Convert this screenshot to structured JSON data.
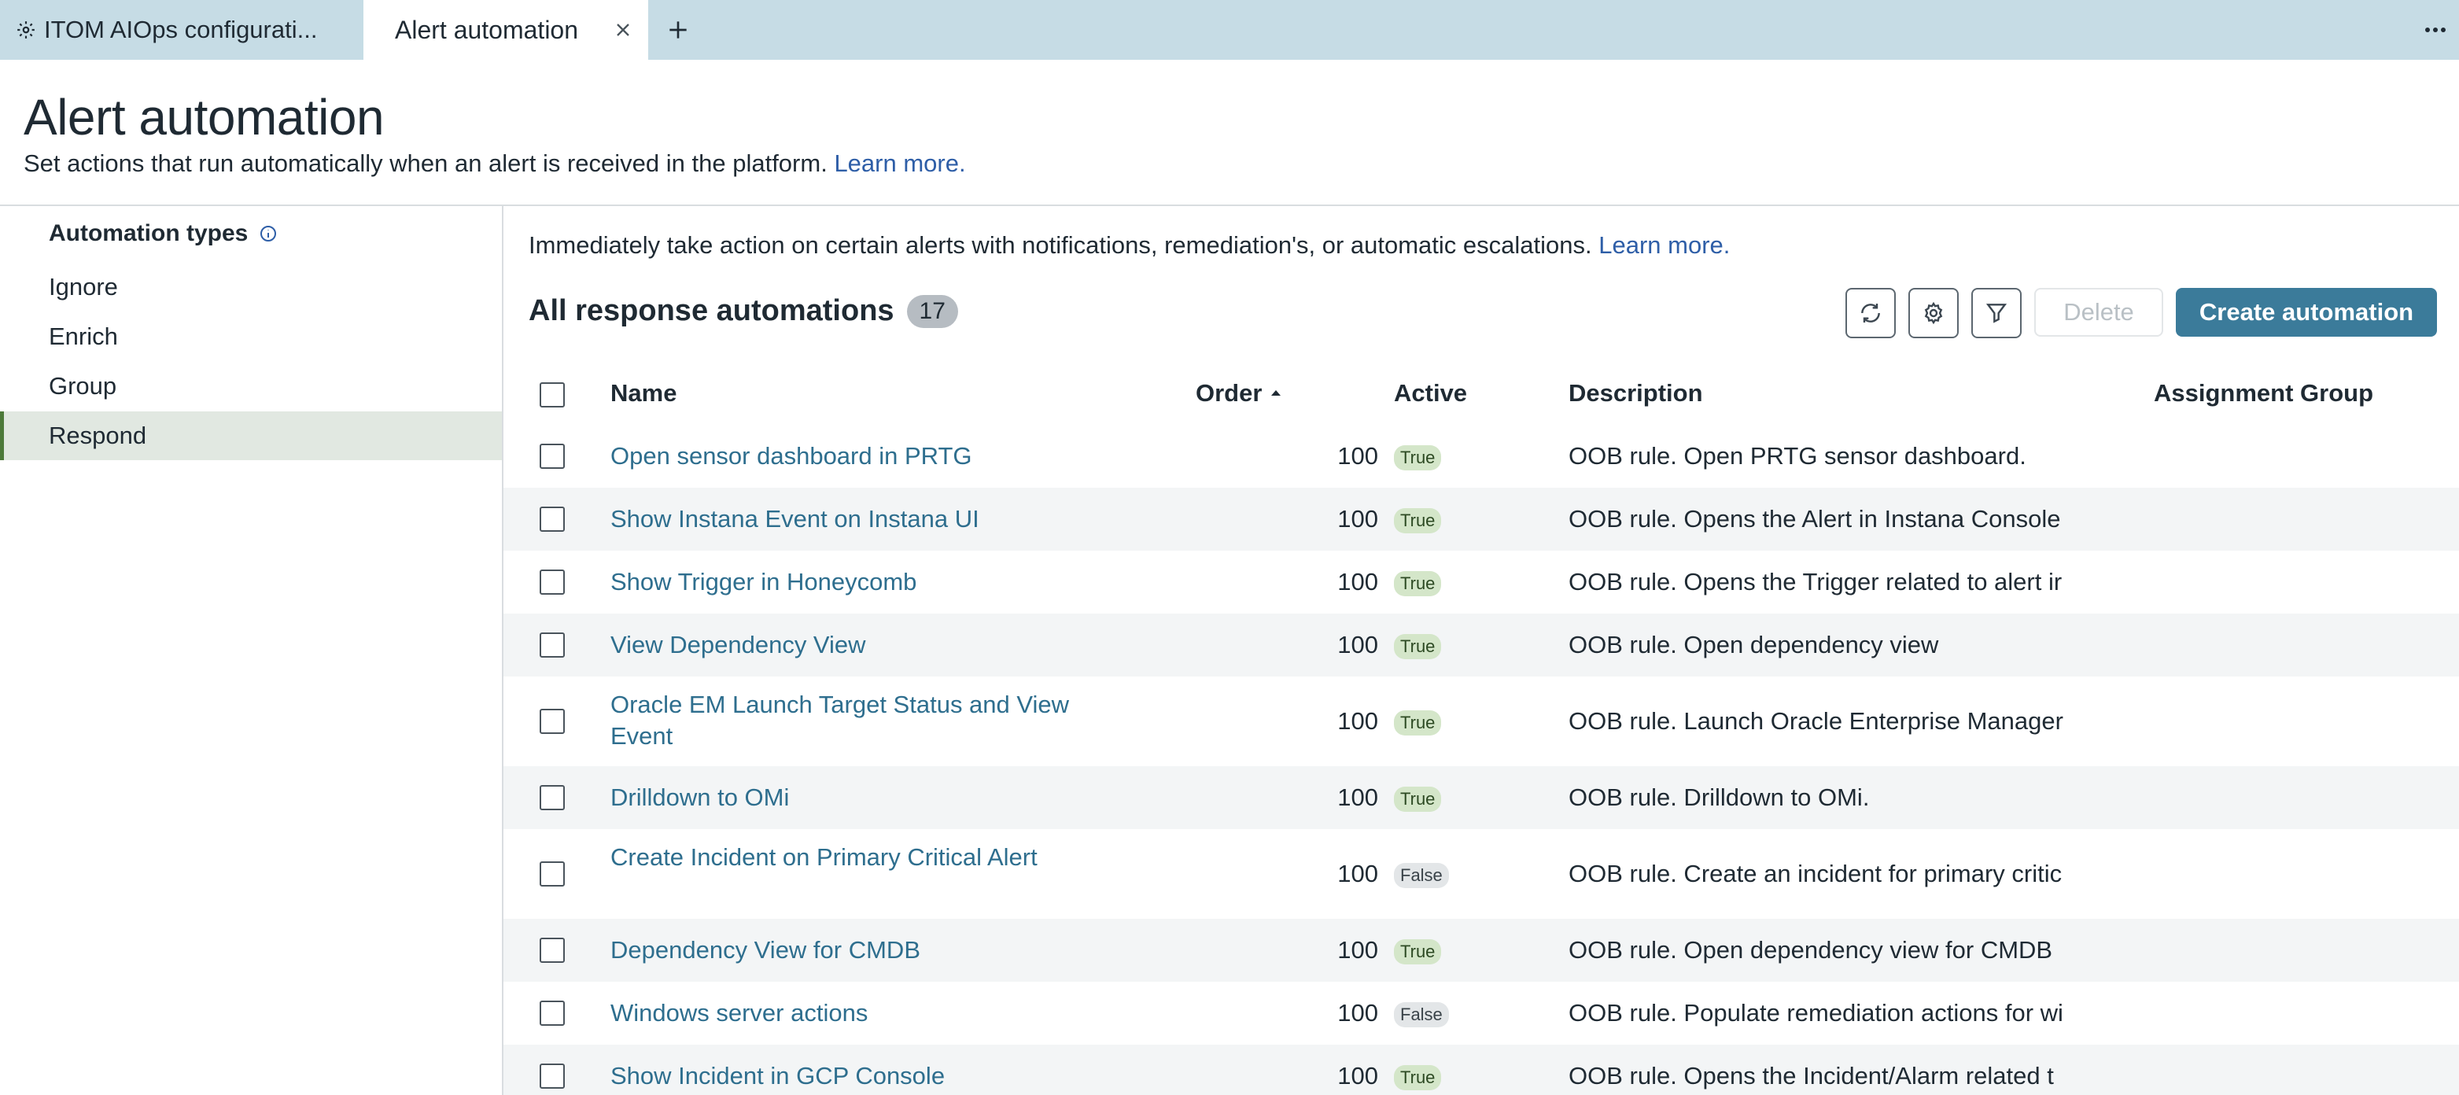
{
  "tabs": {
    "inactive_label": "ITOM AIOps configurati...",
    "active_label": "Alert automation"
  },
  "header": {
    "title": "Alert automation",
    "subtitle": "Set actions that run automatically when an alert is received in the platform.",
    "learn_more": "Learn more."
  },
  "sidebar": {
    "heading": "Automation types",
    "items": [
      {
        "label": "Ignore"
      },
      {
        "label": "Enrich"
      },
      {
        "label": "Group"
      },
      {
        "label": "Respond"
      }
    ],
    "active_item": "Respond"
  },
  "main": {
    "intro": "Immediately take action on certain alerts with notifications, remediation's, or automatic escalations.",
    "learn_more": "Learn more.",
    "list_title": "All response automations",
    "count": "17",
    "buttons": {
      "delete": "Delete",
      "create": "Create automation"
    }
  },
  "table": {
    "columns": {
      "name": "Name",
      "order": "Order",
      "active": "Active",
      "description": "Description",
      "assignment_group": "Assignment Group"
    },
    "sort": {
      "column": "Order",
      "direction": "ascending"
    },
    "rows": [
      {
        "name": "Open sensor dashboard in PRTG",
        "order": "100",
        "active": "True",
        "description": "OOB rule. Open PRTG sensor dashboard."
      },
      {
        "name": "Show Instana Event on Instana UI",
        "order": "100",
        "active": "True",
        "description": "OOB rule. Opens the Alert in Instana Console"
      },
      {
        "name": "Show Trigger in Honeycomb",
        "order": "100",
        "active": "True",
        "description": "OOB rule. Opens the Trigger related to alert ir"
      },
      {
        "name": "View Dependency View",
        "order": "100",
        "active": "True",
        "description": "OOB rule. Open dependency view"
      },
      {
        "name": "Oracle EM Launch Target Status and View Event",
        "order": "100",
        "active": "True",
        "description": "OOB rule. Launch Oracle Enterprise Manager"
      },
      {
        "name": "Drilldown to OMi",
        "order": "100",
        "active": "True",
        "description": "OOB rule. Drilldown to OMi."
      },
      {
        "name": "Create Incident on Primary Critical Alert",
        "order": "100",
        "active": "False",
        "description": "OOB rule. Create an incident for primary critic"
      },
      {
        "name": "Dependency View for CMDB",
        "order": "100",
        "active": "True",
        "description": "OOB rule. Open dependency view for CMDB"
      },
      {
        "name": "Windows server actions",
        "order": "100",
        "active": "False",
        "description": "OOB rule. Populate remediation actions for wi"
      },
      {
        "name": "Show Incident in GCP Console",
        "order": "100",
        "active": "True",
        "description": "OOB rule. Opens the Incident/Alarm related t"
      }
    ]
  },
  "colors": {
    "tabbar_bg": "#c6dce5",
    "link": "#2e5ea7",
    "row_link": "#2e6e8e",
    "primary_button": "#3b7b9a",
    "active_sidebar_bg": "#e1e8e1",
    "active_sidebar_accent": "#4d7a3a",
    "true_pill": "#d4e6c9",
    "false_pill": "#e3e6e8"
  },
  "icons": [
    "gear-icon",
    "close-icon",
    "plus-icon",
    "more-icon",
    "info-icon",
    "refresh-icon",
    "settings-icon",
    "filter-icon",
    "sort-ascending-icon"
  ]
}
